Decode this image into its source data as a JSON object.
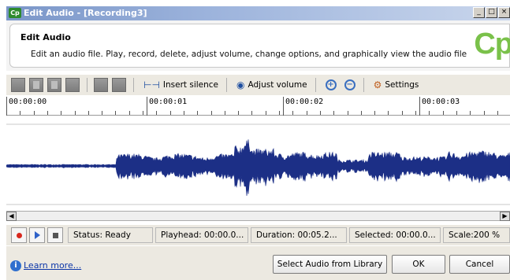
{
  "window": {
    "app_icon": "Cp",
    "title": "Edit Audio - [Recording3]",
    "buttons": [
      "_",
      "□",
      "×"
    ]
  },
  "header": {
    "title": "Edit Audio",
    "description": "Edit an audio file. Play, record, delete, adjust volume, change options, and graphically view the audio file",
    "logo_text": "Cp",
    "logo_color": "#7ac14a"
  },
  "toolbar": {
    "icons": [
      "cut-icon",
      "copy-icon",
      "paste-icon",
      "delete-icon",
      "silence-block-icon",
      "trim-icon"
    ],
    "insert_silence": "Insert silence",
    "adjust_volume": "Adjust volume",
    "zoom_in": "+",
    "zoom_out": "−",
    "settings": "Settings"
  },
  "ruler": {
    "ticks": [
      "00:00:00",
      "00:00:01",
      "00:00:02",
      "00:00:03"
    ]
  },
  "waveform": {
    "color": "#1c2f86"
  },
  "statusbar": {
    "status": "Status: Ready",
    "playhead": "Playhead: 00:00.0...",
    "duration": "Duration: 00:05.2...",
    "selected": "Selected: 00:00.0...",
    "scale": "Scale:200 %"
  },
  "footer": {
    "learn_more": "Learn more...",
    "select_library": "Select Audio from Library",
    "ok": "OK",
    "cancel": "Cancel"
  }
}
